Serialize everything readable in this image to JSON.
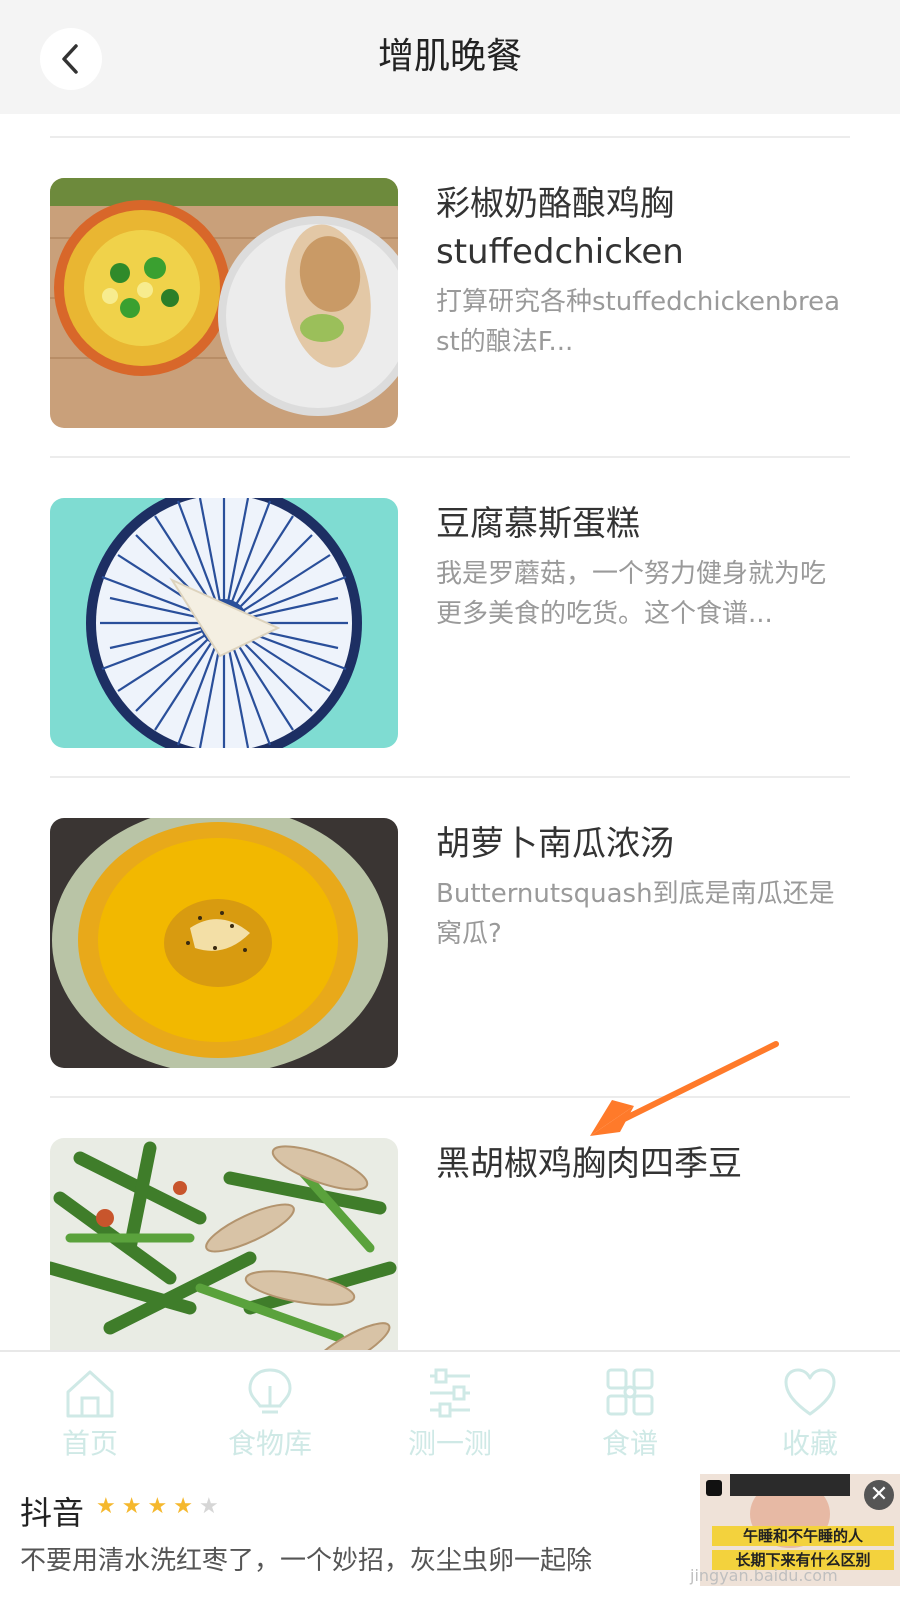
{
  "header": {
    "title": "增肌晚餐"
  },
  "recipes": [
    {
      "title": "彩椒奶酪酿鸡胸stuffedchicken",
      "desc": "打算研究各种stuffedchickenbreast的酿法F..."
    },
    {
      "title": "豆腐慕斯蛋糕",
      "desc": "我是罗蘑菇，一个努力健身就为吃更多美食的吃货。这个食谱..."
    },
    {
      "title": "胡萝卜南瓜浓汤",
      "desc": "Butternutsquash到底是南瓜还是窝瓜?"
    },
    {
      "title": "黑胡椒鸡胸肉四季豆",
      "desc": ""
    }
  ],
  "tabbar": {
    "items": [
      {
        "label": "首页",
        "icon": "home-icon"
      },
      {
        "label": "食物库",
        "icon": "lightbulb-icon"
      },
      {
        "label": "测一测",
        "icon": "sliders-icon"
      },
      {
        "label": "食谱",
        "icon": "grid-icon"
      },
      {
        "label": "收藏",
        "icon": "heart-icon"
      }
    ],
    "color": "#cfe9e6"
  },
  "ad": {
    "brand": "抖音",
    "rating": 4,
    "rating_max": 5,
    "text": "不要用清水洗红枣了，一个妙招，灰尘虫卵一起除",
    "thumb_line1": "午睡和不午睡的人",
    "thumb_line2": "长期下来有什么区别"
  },
  "watermark": "jingyan.baidu.com",
  "colors": {
    "accent": "#ff7a2a",
    "header_bg": "#f4f4f4",
    "divider": "#ececec"
  }
}
